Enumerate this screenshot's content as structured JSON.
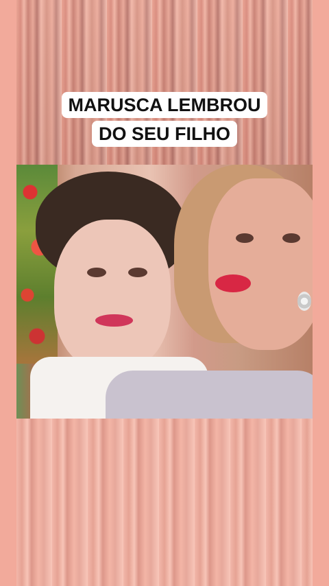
{
  "caption": {
    "line1": "MARUSCA LEMBROU",
    "line2": "DO SEU FILHO"
  },
  "colors": {
    "frame": "#f2aa9b",
    "caption_bg": "#ffffff",
    "caption_text": "#111111"
  }
}
